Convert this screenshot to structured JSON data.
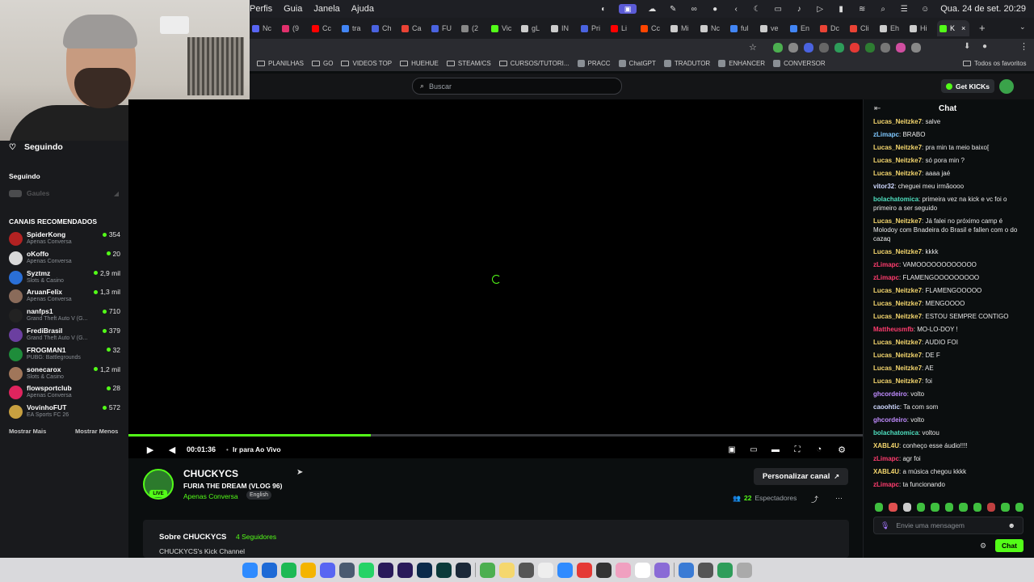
{
  "menubar": {
    "menus": [
      "Perfis",
      "Guia",
      "Janela",
      "Ajuda"
    ],
    "datetime": "Qua. 24 de set.  20:29"
  },
  "tabs": [
    {
      "label": "Nc",
      "color": "#5865f2"
    },
    {
      "label": "(9",
      "color": "#e1306c"
    },
    {
      "label": "Cc",
      "color": "#ff0000"
    },
    {
      "label": "tra",
      "color": "#4285f4"
    },
    {
      "label": "Ch",
      "color": "#4a63e0"
    },
    {
      "label": "Ca",
      "color": "#ea4335"
    },
    {
      "label": "FU",
      "color": "#4a63e0"
    },
    {
      "label": "(2",
      "color": "#888888"
    },
    {
      "label": "Vic",
      "color": "#53fc18"
    },
    {
      "label": "gL",
      "color": "#cccccc"
    },
    {
      "label": "IN",
      "color": "#cccccc"
    },
    {
      "label": "Pri",
      "color": "#4a63e0"
    },
    {
      "label": "Li",
      "color": "#ff0000"
    },
    {
      "label": "Cc",
      "color": "#ff4500"
    },
    {
      "label": "Mi",
      "color": "#cccccc"
    },
    {
      "label": "Nc",
      "color": "#cccccc"
    },
    {
      "label": "ful",
      "color": "#4285f4"
    },
    {
      "label": "ve",
      "color": "#cccccc"
    },
    {
      "label": "En",
      "color": "#4285f4"
    },
    {
      "label": "Dc",
      "color": "#ea4335"
    },
    {
      "label": "Cli",
      "color": "#ea4335"
    },
    {
      "label": "Eh",
      "color": "#cccccc"
    },
    {
      "label": "Hi",
      "color": "#cccccc"
    },
    {
      "label": "K",
      "color": "#53fc18",
      "active": true
    }
  ],
  "bookmarks": [
    {
      "label": "PLANILHAS",
      "icon": "folder-icon"
    },
    {
      "label": "GO",
      "icon": "folder-icon"
    },
    {
      "label": "VIDEOS TOP",
      "icon": "folder-icon"
    },
    {
      "label": "HUEHUE",
      "icon": "folder-icon"
    },
    {
      "label": "STEAM/CS",
      "icon": "folder-icon"
    },
    {
      "label": "CURSOS/TUTORI...",
      "icon": "folder-icon"
    },
    {
      "label": "PRACC",
      "icon": "pracc-icon"
    },
    {
      "label": "ChatGPT",
      "icon": "chatgpt-icon"
    },
    {
      "label": "TRADUTOR",
      "icon": "translate-icon"
    },
    {
      "label": "ENHANCER",
      "icon": "enhancer-icon"
    },
    {
      "label": "CONVERSOR",
      "icon": "conversor-icon"
    }
  ],
  "bookmarks_right": "Todos os favoritos",
  "kick_header": {
    "search_placeholder": "Buscar",
    "get_kicks": "Get KICKs"
  },
  "sidebar": {
    "following_title": "Seguindo",
    "following_label": "Seguindo",
    "followed_offline": "Gaules",
    "recommended_label": "CANAIS RECOMENDADOS",
    "channels": [
      {
        "name": "SpiderKong",
        "category": "Apenas Conversa",
        "viewers": "354",
        "color": "#b22222"
      },
      {
        "name": "oKoffo",
        "category": "Apenas Conversa",
        "viewers": "20",
        "color": "#d9d9d9"
      },
      {
        "name": "Syztmz",
        "category": "Slots & Casino",
        "viewers": "2,9 mil",
        "color": "#2a6fd6"
      },
      {
        "name": "AruanFelix",
        "category": "Apenas Conversa",
        "viewers": "1,3 mil",
        "color": "#8a6b5a"
      },
      {
        "name": "nanfps1",
        "category": "Grand Theft Auto V (G...",
        "viewers": "710",
        "color": "#222222"
      },
      {
        "name": "FrediBrasil",
        "category": "Grand Theft Auto V (G...",
        "viewers": "379",
        "color": "#6b3fa0"
      },
      {
        "name": "FROGMAN1",
        "category": "PUBG: Battlegrounds",
        "viewers": "32",
        "color": "#1e8c3a"
      },
      {
        "name": "sonecarox",
        "category": "Slots & Casino",
        "viewers": "1,2 mil",
        "color": "#a0765a"
      },
      {
        "name": "flowsportclub",
        "category": "Apenas Conversa",
        "viewers": "28",
        "color": "#e0245e"
      },
      {
        "name": "VovinhoFUT",
        "category": "EA Sports FC 26",
        "viewers": "572",
        "color": "#c8a040"
      }
    ],
    "show_more": "Mostrar Mais",
    "show_less": "Mostrar Menos"
  },
  "player": {
    "time": "00:01:36",
    "go_live": "Ir para Ao Vivo",
    "progress": 0.33
  },
  "stream": {
    "channel": "CHUCKYCS",
    "title": "FURIA THE DREAM (VLOG 96)",
    "category": "Apenas Conversa",
    "tag": "English",
    "live_badge": "LIVE",
    "customize": "Personalizar canal",
    "viewers_count": "22",
    "viewers_label": "Espectadores",
    "about_title": "Sobre CHUCKYCS",
    "followers": "4 Seguidores",
    "about_text": "CHUCKYCS's Kick Channel"
  },
  "chat": {
    "title": "Chat",
    "messages": [
      {
        "user": "Lucas_Neitzke7",
        "color": "#f5d76e",
        "text": "salve"
      },
      {
        "user": "zLimapc",
        "color": "#7ec8ff",
        "text": "BRABO"
      },
      {
        "user": "Lucas_Neitzke7",
        "color": "#f5d76e",
        "text": "pra min ta meio baixo["
      },
      {
        "user": "Lucas_Neitzke7",
        "color": "#f5d76e",
        "text": "só pora min ?"
      },
      {
        "user": "Lucas_Neitzke7",
        "color": "#f5d76e",
        "text": "aaaa jaé"
      },
      {
        "user": "vitor32",
        "color": "#cfd8ff",
        "text": "cheguei meu irmãoooo"
      },
      {
        "user": "bolachatomica",
        "color": "#4fe0c0",
        "text": "primeira vez na kick e vc foi o primeiro a ser seguido"
      },
      {
        "user": "Lucas_Neitzke7",
        "color": "#f5d76e",
        "text": "Já falei no próximo camp é Molodoy com Bnadeira do Brasil e fallen com o do cazaq"
      },
      {
        "user": "Lucas_Neitzke7",
        "color": "#f5d76e",
        "text": "kkkk"
      },
      {
        "user": "zLimapc",
        "color": "#ff3c6e",
        "text": "VAMOOOOOOOOOOOO"
      },
      {
        "user": "zLimapc",
        "color": "#ff3c6e",
        "text": "FLAMENGOOOOOOOOO"
      },
      {
        "user": "Lucas_Neitzke7",
        "color": "#f5d76e",
        "text": "FLAMENGOOOOO"
      },
      {
        "user": "Lucas_Neitzke7",
        "color": "#f5d76e",
        "text": "MENGOOOO"
      },
      {
        "user": "Lucas_Neitzke7",
        "color": "#f5d76e",
        "text": "ESTOU SEMPRE CONTIGO"
      },
      {
        "user": "Mattheusmfb",
        "color": "#ff3c6e",
        "text": "MO-LO-DOY !"
      },
      {
        "user": "Lucas_Neitzke7",
        "color": "#f5d76e",
        "text": "AUDIO FOI"
      },
      {
        "user": "Lucas_Neitzke7",
        "color": "#f5d76e",
        "text": "DE F"
      },
      {
        "user": "Lucas_Neitzke7",
        "color": "#f5d76e",
        "text": "AE"
      },
      {
        "user": "Lucas_Neitzke7",
        "color": "#f5d76e",
        "text": "foi"
      },
      {
        "user": "ghcordeiro",
        "color": "#c08cff",
        "text": "volto"
      },
      {
        "user": "caoohtic",
        "color": "#cfd8ff",
        "text": "Ta com som"
      },
      {
        "user": "ghcordeiro",
        "color": "#c08cff",
        "text": "volto"
      },
      {
        "user": "bolachatomica",
        "color": "#4fe0c0",
        "text": "voltou"
      },
      {
        "user": "XABL4U",
        "color": "#f5d76e",
        "text": "conheço esse áudio!!!!"
      },
      {
        "user": "zLimapc",
        "color": "#ff3c6e",
        "text": "agr foi"
      },
      {
        "user": "XABL4U",
        "color": "#f5d76e",
        "text": "a música chegou kkkk"
      },
      {
        "user": "zLimapc",
        "color": "#ff3c6e",
        "text": "ta funcionando"
      }
    ],
    "input_placeholder": "Envie uma mensagem",
    "send": "Chat"
  }
}
